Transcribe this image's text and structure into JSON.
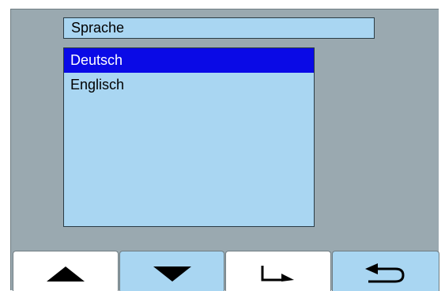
{
  "header": {
    "title": "Sprache"
  },
  "language_list": {
    "items": [
      {
        "label": "Deutsch",
        "selected": true
      },
      {
        "label": "Englisch",
        "selected": false
      }
    ]
  },
  "softkeys": [
    {
      "icon": "arrow-up-icon"
    },
    {
      "icon": "arrow-down-icon"
    },
    {
      "icon": "enter-icon"
    },
    {
      "icon": "return-back-icon"
    }
  ],
  "colors": {
    "panel_background": "#9aa9b0",
    "field_background": "#a9d6f2",
    "selection_highlight": "#0a0ae6"
  }
}
